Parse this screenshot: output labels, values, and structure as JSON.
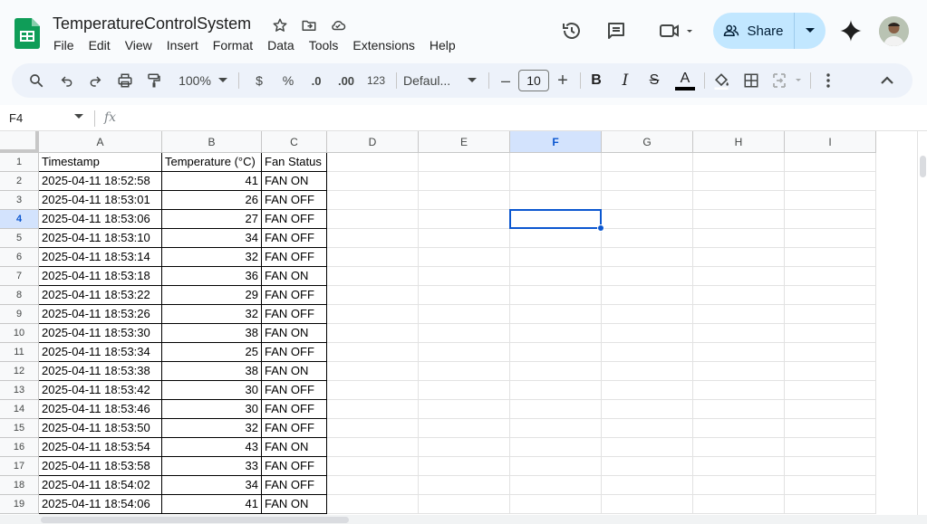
{
  "app": {
    "doc_title": "TemperatureControlSystem"
  },
  "menu": [
    "File",
    "Edit",
    "View",
    "Insert",
    "Format",
    "Data",
    "Tools",
    "Extensions",
    "Help"
  ],
  "share": {
    "label": "Share"
  },
  "toolbar": {
    "zoom": "100%",
    "currency": "$",
    "percent": "%",
    "dec_decrease": ".0",
    "dec_increase": ".00",
    "number_format": "123",
    "font_name": "Defaul...",
    "font_size": "10",
    "minus": "–",
    "plus": "+",
    "bold": "B",
    "italic": "I",
    "strike": "S",
    "text_color": "A"
  },
  "formula_bar": {
    "name_box": "F4",
    "fx": "fx"
  },
  "columns": [
    "A",
    "B",
    "C",
    "D",
    "E",
    "F",
    "G",
    "H",
    "I"
  ],
  "selected_column": "F",
  "selected_row": "4",
  "rows": [
    {
      "num": "1",
      "a": "Timestamp",
      "b": "Temperature (°C)",
      "c": "Fan Status"
    },
    {
      "num": "2",
      "a": "2025-04-11 18:52:58",
      "b": "41",
      "c": "FAN ON"
    },
    {
      "num": "3",
      "a": "2025-04-11 18:53:01",
      "b": "26",
      "c": "FAN OFF"
    },
    {
      "num": "4",
      "a": "2025-04-11 18:53:06",
      "b": "27",
      "c": "FAN OFF"
    },
    {
      "num": "5",
      "a": "2025-04-11 18:53:10",
      "b": "34",
      "c": "FAN OFF"
    },
    {
      "num": "6",
      "a": "2025-04-11 18:53:14",
      "b": "32",
      "c": "FAN OFF"
    },
    {
      "num": "7",
      "a": "2025-04-11 18:53:18",
      "b": "36",
      "c": "FAN ON"
    },
    {
      "num": "8",
      "a": "2025-04-11 18:53:22",
      "b": "29",
      "c": "FAN OFF"
    },
    {
      "num": "9",
      "a": "2025-04-11 18:53:26",
      "b": "32",
      "c": "FAN OFF"
    },
    {
      "num": "10",
      "a": "2025-04-11 18:53:30",
      "b": "38",
      "c": "FAN ON"
    },
    {
      "num": "11",
      "a": "2025-04-11 18:53:34",
      "b": "25",
      "c": "FAN OFF"
    },
    {
      "num": "12",
      "a": "2025-04-11 18:53:38",
      "b": "38",
      "c": "FAN ON"
    },
    {
      "num": "13",
      "a": "2025-04-11 18:53:42",
      "b": "30",
      "c": "FAN OFF"
    },
    {
      "num": "14",
      "a": "2025-04-11 18:53:46",
      "b": "30",
      "c": "FAN OFF"
    },
    {
      "num": "15",
      "a": "2025-04-11 18:53:50",
      "b": "32",
      "c": "FAN OFF"
    },
    {
      "num": "16",
      "a": "2025-04-11 18:53:54",
      "b": "43",
      "c": "FAN ON"
    },
    {
      "num": "17",
      "a": "2025-04-11 18:53:58",
      "b": "33",
      "c": "FAN OFF"
    },
    {
      "num": "18",
      "a": "2025-04-11 18:54:02",
      "b": "34",
      "c": "FAN OFF"
    },
    {
      "num": "19",
      "a": "2025-04-11 18:54:06",
      "b": "41",
      "c": "FAN ON"
    }
  ]
}
